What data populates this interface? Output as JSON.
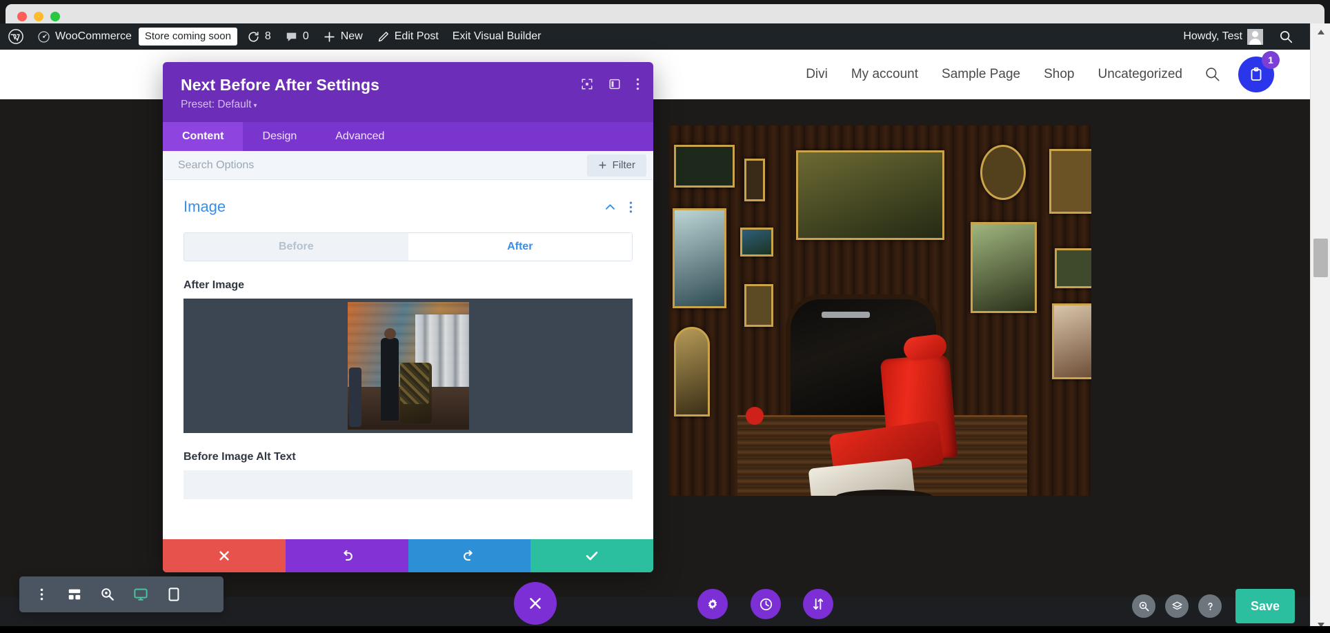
{
  "window": {
    "traffic_lights": [
      "close",
      "minimize",
      "maximize"
    ]
  },
  "admin_bar": {
    "wp_logo": "wordpress-icon",
    "items": [
      {
        "label": "WooCommerce",
        "icon": "speedometer-icon"
      },
      {
        "label": "Store coming soon",
        "icon": "badge"
      },
      {
        "label": "8",
        "icon": "updates-icon"
      },
      {
        "label": "0",
        "icon": "comment-icon"
      },
      {
        "label": "New",
        "icon": "plus-icon"
      },
      {
        "label": "Edit Post",
        "icon": "pencil-icon"
      },
      {
        "label": "Exit Visual Builder",
        "icon": "none"
      }
    ],
    "howdy": "Howdy, Test",
    "search_icon": "search-icon"
  },
  "site_nav": {
    "links": [
      "Divi",
      "My account",
      "Sample Page",
      "Shop",
      "Uncategorized"
    ],
    "search_icon": "search-icon",
    "cart_icon": "cart-icon",
    "cart_count": "1",
    "cart_color": "#2b35ea",
    "badge_color": "#7b3fd6"
  },
  "modal": {
    "title": "Next Before After Settings",
    "preset_label": "Preset: Default",
    "preset_caret": "▾",
    "header_icons": [
      "fullscreen-icon",
      "panel-layout-icon",
      "more-vertical-icon"
    ],
    "tabs": [
      {
        "label": "Content",
        "active": true
      },
      {
        "label": "Design",
        "active": false
      },
      {
        "label": "Advanced",
        "active": false
      }
    ],
    "search_placeholder": "Search Options",
    "filter_label": "Filter",
    "filter_icon": "plus-icon",
    "section": {
      "title": "Image",
      "collapse_icon": "chevron-up-icon",
      "more_icon": "more-vertical-icon"
    },
    "image_toggle": [
      {
        "label": "Before",
        "active": false
      },
      {
        "label": "After",
        "active": true
      }
    ],
    "after_image_label": "After Image",
    "after_image_alt_desc": "barbershop-interior-photo",
    "alt_text_label": "Before Image Alt Text",
    "alt_text_value": "",
    "alt_text_placeholder": "",
    "footer_buttons": [
      {
        "name": "discard",
        "icon": "close-icon",
        "color": "#e8524c"
      },
      {
        "name": "undo",
        "icon": "undo-icon",
        "color": "#8332d6"
      },
      {
        "name": "redo",
        "icon": "redo-icon",
        "color": "#2d8fd5"
      },
      {
        "name": "save",
        "icon": "check-icon",
        "color": "#2bbfa0"
      }
    ],
    "accent_header_color": "#6c2eb9",
    "accent_tab_color": "#8e45e0"
  },
  "divi_bar": {
    "left_icons": [
      "more-vertical-icon",
      "wireframe-icon",
      "zoom-icon",
      "desktop-icon",
      "tablet-icon"
    ],
    "active_view": "desktop-icon",
    "close_icon": "close-icon",
    "fabs": [
      "gear-icon",
      "clock-icon",
      "sort-arrows-icon"
    ],
    "right_icons": [
      "zoom-icon",
      "layers-icon",
      "help-icon"
    ],
    "save_label": "Save",
    "save_color": "#2bbfa0",
    "fab_color": "#7b2fd4"
  },
  "scrollbar": {
    "up_arrow": "chevron-up-icon",
    "down_arrow": "chevron-down-icon"
  },
  "hero": {
    "alt": "vintage-barbershop-red-chair-photo"
  }
}
